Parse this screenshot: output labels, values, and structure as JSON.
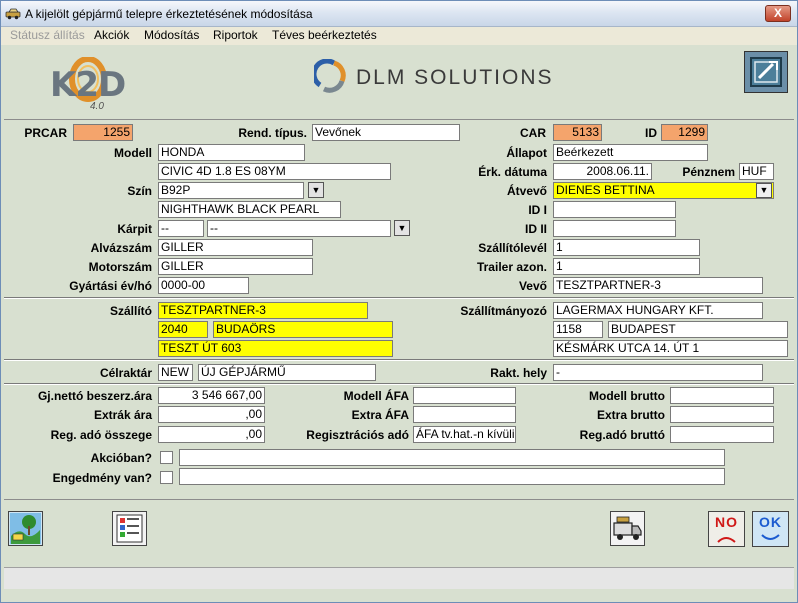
{
  "window": {
    "title": "A kijelölt gépjármű telepre érkeztetésének módosítása",
    "close_label": "X"
  },
  "menu": {
    "items": [
      "Státusz állítás",
      "Akciók",
      "Módosítás",
      "Riportok",
      "Téves beérkeztetés"
    ]
  },
  "header": {
    "k2d_logo": "K2D",
    "k2d_version": "4.0",
    "brand": "DLM SOLUTIONS"
  },
  "colors": {
    "yellow": "#ffff00",
    "orange": "#f4a46c",
    "background": "#d8e0d0"
  },
  "vehicle": {
    "prcar_label": "PRCAR",
    "prcar": "1255",
    "rend_tipus_label": "Rend. típus.",
    "rend_tipus": "Vevőnek",
    "car_label": "CAR",
    "car": "5133",
    "id_label": "ID",
    "id": "1299",
    "modell_label": "Modell",
    "modell": "HONDA",
    "modell_desc": "CIVIC 4D 1.8 ES 08YM",
    "allapot_label": "Állapot",
    "allapot": "Beérkezett",
    "erk_datuma_label": "Érk. dátuma",
    "erk_datuma": "2008.06.11.",
    "penznem_label": "Pénznem",
    "penznem": "HUF",
    "szin_label": "Szín",
    "szin": "B92P",
    "szin_desc": "NIGHTHAWK BLACK PEARL",
    "atvevo_label": "Átvevő",
    "atvevo": "DIENES BETTINA",
    "id1_label": "ID I",
    "id1": "",
    "karpit_label": "Kárpit",
    "karpit": "--",
    "karpit_desc": "--",
    "id2_label": "ID II",
    "id2": "",
    "alvazszam_label": "Alvázszám",
    "alvazszam": "GILLER",
    "szallitolevel_label": "Szállítólevél",
    "szallitolevel": "1",
    "motorszam_label": "Motorszám",
    "motorszam": "GILLER",
    "trailer_label": "Trailer azon.",
    "trailer": "1",
    "gyartasi_label": "Gyártási év/hó",
    "gyartasi": "0000-00",
    "vevo_label": "Vevő",
    "vevo": "TESZTPARTNER-3"
  },
  "shipping": {
    "szallito_label": "Szállító",
    "szallito": "TESZTPARTNER-3",
    "szallito_zip": "2040",
    "szallito_city": "BUDAÖRS",
    "szallito_street": "TESZT ÚT 603",
    "szallitmanyozo_label": "Szállítmányozó",
    "szallitmanyozo": "LAGERMAX HUNGARY KFT.",
    "szallitmanyozo_zip": "1158",
    "szallitmanyozo_city": "BUDAPEST",
    "szallitmanyozo_street": "KÉSMÁRK UTCA 14. ÚT 1"
  },
  "warehouse": {
    "celraktar_label": "Célraktár",
    "celraktar_code": "NEW",
    "celraktar_name": "ÚJ GÉPJÁRMŰ",
    "rakt_hely_label": "Rakt. hely",
    "rakt_hely": "-"
  },
  "pricing": {
    "gj_netto_label": "Gj.nettó beszerz.ára",
    "gj_netto": "3 546 667,00",
    "modell_afa_label": "Modell ÁFA",
    "modell_afa": "",
    "modell_brutto_label": "Modell brutto",
    "modell_brutto": "",
    "extrak_ara_label": "Extrák ára",
    "extrak_ara": ",00",
    "extra_afa_label": "Extra ÁFA",
    "extra_afa": "",
    "extra_brutto_label": "Extra brutto",
    "extra_brutto": "",
    "reg_ado_label": "Reg. adó összege",
    "reg_ado": ",00",
    "regisztracios_ado_label": "Regisztrációs adó",
    "regisztracios_ado": "ÁFA tv.hat.-n kívüli",
    "reg_ado_brutto_label": "Reg.adó bruttó",
    "reg_ado_brutto": ""
  },
  "flags": {
    "akcioban_label": "Akcióban?",
    "akcioban_text": "",
    "engedmeny_label": "Engedmény van?",
    "engedmeny_text": ""
  },
  "buttons": {
    "no_label": "NO",
    "ok_label": "OK"
  }
}
